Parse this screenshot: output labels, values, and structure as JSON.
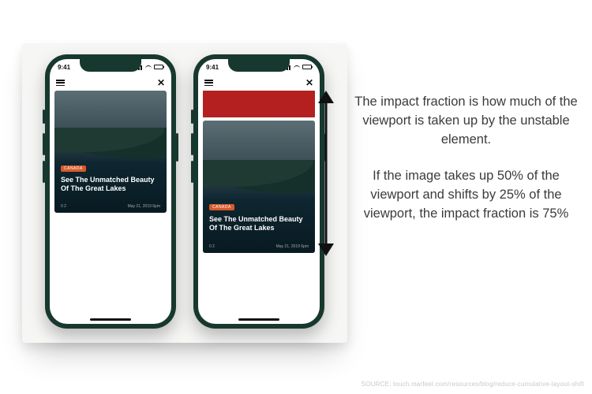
{
  "status": {
    "time": "9:41"
  },
  "topbar": {
    "brand": ""
  },
  "card": {
    "tag": "Canada",
    "headline": "See The Unmatched Beauty Of The Great Lakes",
    "meta_left": "0 2",
    "meta_right": "May 21, 2019 6pm"
  },
  "explain": {
    "p1": "The impact fraction is how much of the viewport is taken up by the unstable element.",
    "p2": "If the image takes up 50% of the viewport and shifts by 25% of the viewport, the impact fraction is 75%"
  },
  "source": {
    "label": "SOURCE",
    "url": "touch.marfeel.com/resources/blog/reduce-cumulative-layout-shift"
  },
  "colors": {
    "frame": "#17382e",
    "banner": "#b3201f",
    "tag": "#d75a2b"
  }
}
